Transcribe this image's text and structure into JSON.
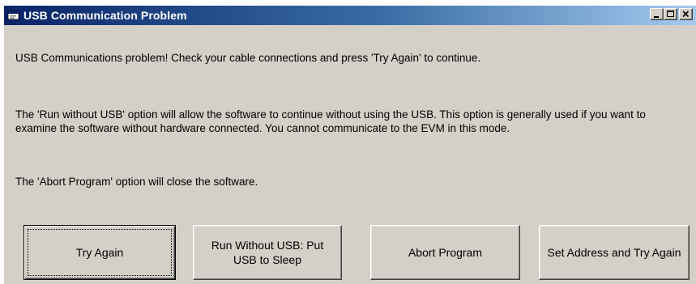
{
  "window": {
    "title": "USB Communication Problem",
    "icon": "app-window-icon",
    "controls": {
      "minimize": "minimize-icon",
      "maximize": "maximize-icon",
      "close": "close-icon"
    }
  },
  "messages": {
    "line1": "USB Communications problem!  Check your cable connections and press 'Try Again' to continue.",
    "line2": "The 'Run without USB' option will allow the software to continue without using the USB.  This option is generally used if you want to examine the software without hardware connected.  You cannot communicate to the EVM in this mode.",
    "line3": "The 'Abort Program' option will close the software."
  },
  "buttons": {
    "try_again": "Try Again",
    "run_without_usb": "Run Without USB:  Put\nUSB to Sleep",
    "abort": "Abort Program",
    "set_address": "Set Address and Try Again"
  },
  "colors": {
    "titlebar_start": "#0a246a",
    "titlebar_end": "#a6caf0",
    "dialog_bg": "#d4d0c8"
  }
}
